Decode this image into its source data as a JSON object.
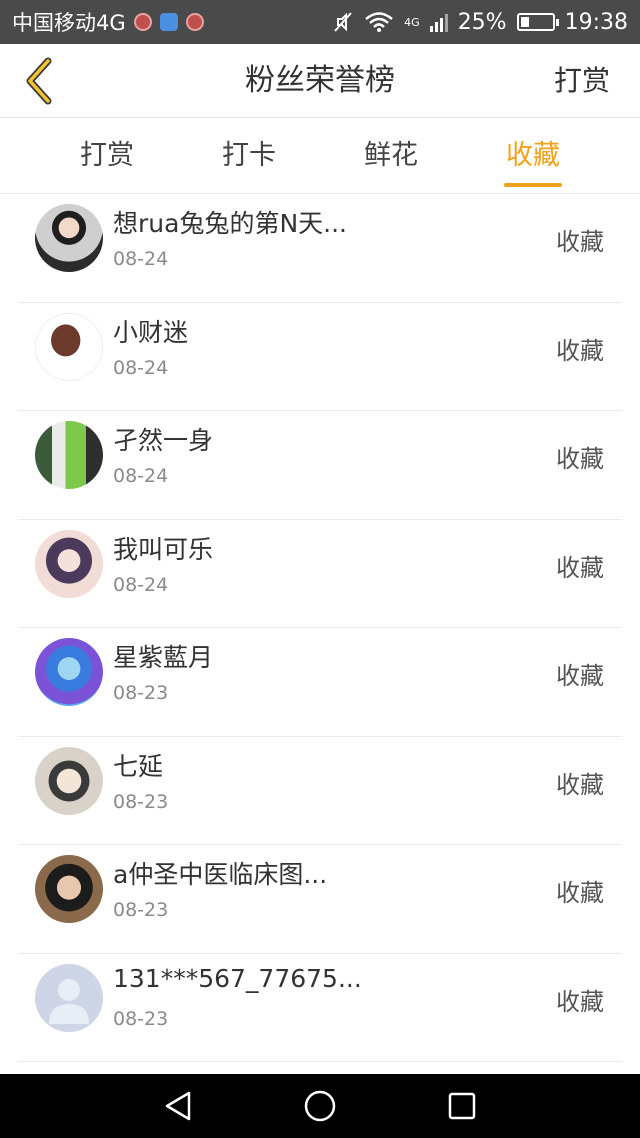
{
  "status_bar": {
    "carrier": "中国移动4G",
    "network_small": "4G",
    "battery": "25%",
    "time": "19:38",
    "battery_level": 0.25
  },
  "header": {
    "title": "粉丝荣誉榜",
    "action": "打赏"
  },
  "tabs": [
    {
      "label": "打赏",
      "active": false
    },
    {
      "label": "打卡",
      "active": false
    },
    {
      "label": "鲜花",
      "active": false
    },
    {
      "label": "收藏",
      "active": true
    }
  ],
  "accent_color": "#f0a21d",
  "list": [
    {
      "name": "想rua兔兔的第N天...",
      "date": "08-24",
      "action": "收藏",
      "avatar": "avatar-photo-girl-hat"
    },
    {
      "name": "小财迷",
      "date": "08-24",
      "action": "收藏",
      "avatar": "avatar-braid"
    },
    {
      "name": "孑然一身",
      "date": "08-24",
      "action": "收藏",
      "avatar": "avatar-green-dress"
    },
    {
      "name": "我叫可乐",
      "date": "08-24",
      "action": "收藏",
      "avatar": "avatar-anime-girl"
    },
    {
      "name": "星紫藍月",
      "date": "08-23",
      "action": "收藏",
      "avatar": "avatar-anime-blue"
    },
    {
      "name": "七延",
      "date": "08-23",
      "action": "收藏",
      "avatar": "avatar-anime-flowers"
    },
    {
      "name": "a仲圣中医临床图...",
      "date": "08-23",
      "action": "收藏",
      "avatar": "avatar-woman-photo"
    },
    {
      "name": "131***567_77675...",
      "date": "08-23",
      "action": "收藏",
      "avatar": "avatar-default-person"
    }
  ]
}
